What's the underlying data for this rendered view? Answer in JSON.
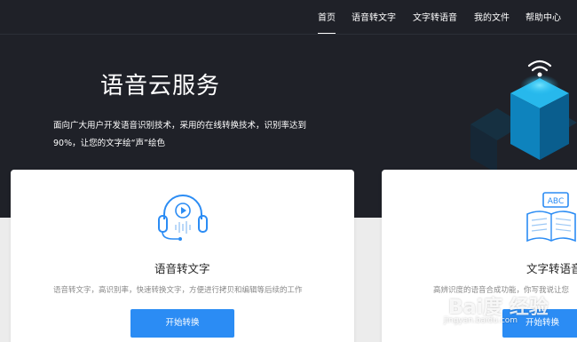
{
  "nav": {
    "items": [
      {
        "label": "首页",
        "active": true
      },
      {
        "label": "语音转文字"
      },
      {
        "label": "文字转语音"
      },
      {
        "label": "我的文件"
      },
      {
        "label": "帮助中心"
      }
    ]
  },
  "hero": {
    "title": "语音云服务",
    "description": "面向广大用户开发语音识别技术，采用的在线转换技术，识别率达到90%，让您的文字绘“声”绘色"
  },
  "cards": [
    {
      "title": "语音转文字",
      "description": "语音转文字，高识别率，快速转换文字，方便进行拷贝和编辑等后续的工作",
      "button": "开始转换",
      "icon": "headset-icon"
    },
    {
      "title": "文字转语音",
      "description": "高辨识度的语音合成功能，你写我说让您",
      "button": "开始转换",
      "icon": "abc-book-icon"
    }
  ],
  "watermark": {
    "logo": "Bai度 经验",
    "url": "jingyan.baidu.com"
  },
  "colors": {
    "hero_bg": "#1f2128",
    "accent": "#2b8cf4",
    "art_cyan": "#1ab8f0"
  }
}
